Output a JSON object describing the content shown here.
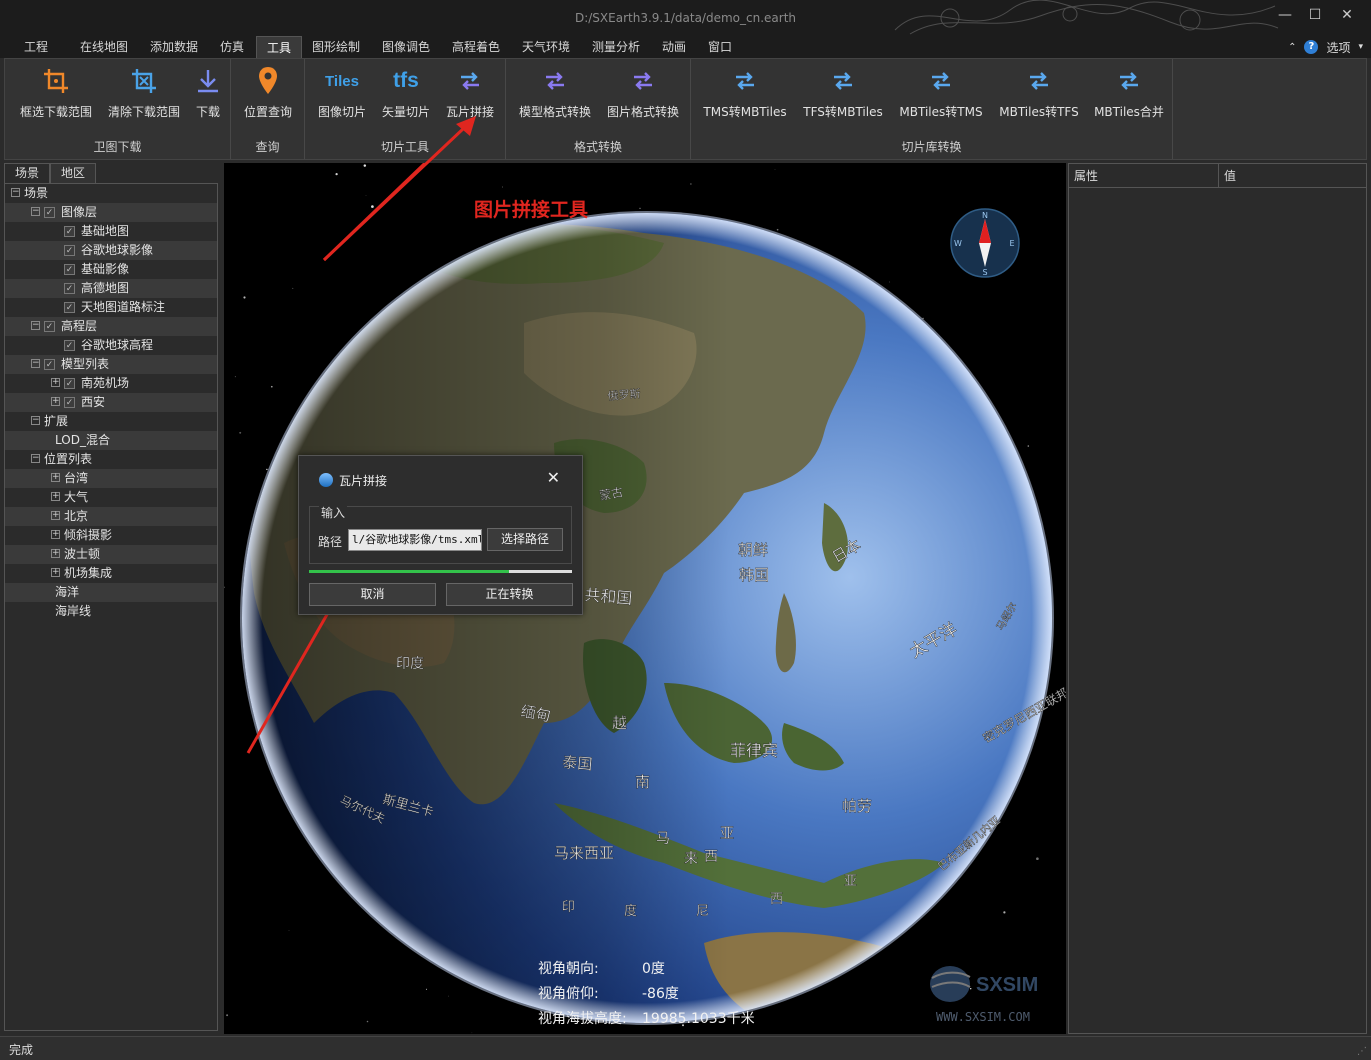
{
  "window": {
    "title": "D:/SXEarth3.9.1/data/demo_cn.earth"
  },
  "menu": {
    "items": [
      "工程",
      "在线地图",
      "添加数据",
      "仿真",
      "工具",
      "图形绘制",
      "图像调色",
      "高程着色",
      "天气环境",
      "测量分析",
      "动画",
      "窗口"
    ],
    "active": "工具",
    "options_label": "选项"
  },
  "ribbon": {
    "groups": [
      {
        "title": "卫图下载",
        "buttons": [
          {
            "label": "框选下载范围",
            "icon": "crop-select-icon"
          },
          {
            "label": "清除下载范围",
            "icon": "crop-clear-icon"
          },
          {
            "label": "下载",
            "icon": "download-icon"
          }
        ]
      },
      {
        "title": "查询",
        "buttons": [
          {
            "label": "位置查询",
            "icon": "location-pin-icon"
          }
        ]
      },
      {
        "title": "切片工具",
        "buttons": [
          {
            "label": "图像切片",
            "icon_text": "Tiles"
          },
          {
            "label": "矢量切片",
            "icon_text": "tfs"
          },
          {
            "label": "瓦片拼接",
            "icon": "swap-arrows-icon"
          }
        ]
      },
      {
        "title": "格式转换",
        "buttons": [
          {
            "label": "模型格式转换",
            "icon": "swap-arrows-icon"
          },
          {
            "label": "图片格式转换",
            "icon": "swap-arrows-icon"
          }
        ]
      },
      {
        "title": "切片库转换",
        "buttons": [
          {
            "label": "TMS转MBTiles"
          },
          {
            "label": "TFS转MBTiles"
          },
          {
            "label": "MBTiles转TMS"
          },
          {
            "label": "MBTiles转TFS"
          },
          {
            "label": "MBTiles合并"
          }
        ]
      }
    ]
  },
  "left_panel": {
    "tabs": [
      "场景",
      "地区"
    ],
    "tree": [
      {
        "label": "场景",
        "level": 0,
        "expander": "−",
        "check": false
      },
      {
        "label": "图像层",
        "level": 1,
        "expander": "−",
        "check": true
      },
      {
        "label": "基础地图",
        "level": 2,
        "expander": "",
        "check": true
      },
      {
        "label": "谷歌地球影像",
        "level": 2,
        "expander": "",
        "check": true
      },
      {
        "label": "基础影像",
        "level": 2,
        "expander": "",
        "check": true
      },
      {
        "label": "高德地图",
        "level": 2,
        "expander": "",
        "check": true
      },
      {
        "label": "天地图道路标注",
        "level": 2,
        "expander": "",
        "check": true
      },
      {
        "label": "高程层",
        "level": 1,
        "expander": "−",
        "check": true
      },
      {
        "label": "谷歌地球高程",
        "level": 2,
        "expander": "",
        "check": true
      },
      {
        "label": "模型列表",
        "level": 1,
        "expander": "−",
        "check": true
      },
      {
        "label": "南苑机场",
        "level": 2,
        "expander": "+",
        "check": true
      },
      {
        "label": "西安",
        "level": 2,
        "expander": "+",
        "check": true
      },
      {
        "label": "扩展",
        "level": 1,
        "expander": "−",
        "check": false
      },
      {
        "label": "LOD_混合",
        "level": 2,
        "expander": "",
        "check": false
      },
      {
        "label": "位置列表",
        "level": 1,
        "expander": "−",
        "check": false
      },
      {
        "label": "台湾",
        "level": 2,
        "expander": "+",
        "check": false
      },
      {
        "label": "大气",
        "level": 2,
        "expander": "+",
        "check": false
      },
      {
        "label": "北京",
        "level": 2,
        "expander": "+",
        "check": false
      },
      {
        "label": "倾斜摄影",
        "level": 2,
        "expander": "+",
        "check": false
      },
      {
        "label": "波士顿",
        "level": 2,
        "expander": "+",
        "check": false
      },
      {
        "label": "机场集成",
        "level": 2,
        "expander": "+",
        "check": false
      },
      {
        "label": "海洋",
        "level": 2,
        "expander": "",
        "check": false
      },
      {
        "label": "海岸线",
        "level": 2,
        "expander": "",
        "check": false
      }
    ]
  },
  "viewport": {
    "caption": "图片拼接工具",
    "globe_labels": [
      "俄罗斯",
      "蒙古",
      "朝鲜",
      "韩国",
      "日本",
      "共和国",
      "印度",
      "缅甸",
      "越",
      "泰国",
      "南",
      "菲律宾",
      "帕劳",
      "马来西亚",
      "马",
      "来",
      "西",
      "亚",
      "斯里兰卡",
      "马尔代夫",
      "印",
      "度",
      "尼",
      "西",
      "亚",
      "太平洋",
      "密克罗尼西亚联邦",
      "巴布亚新几内亚",
      "马绍尔"
    ],
    "compass": {
      "north": "N",
      "south": "S",
      "east": "E",
      "west": "W"
    },
    "hud": {
      "heading_label": "视角朝向:",
      "heading_value": "0度",
      "pitch_label": "视角俯仰:",
      "pitch_value": "-86度",
      "altitude_label": "视角海拔高度:",
      "altitude_value": "19985.1033千米"
    },
    "watermark": {
      "brand": "SXSIM",
      "url": "WWW.SXSIM.COM"
    },
    "accent_color": "#e0261f"
  },
  "dialog": {
    "title": "瓦片拼接",
    "group_label": "输入",
    "path_label": "路径",
    "path_value": "l/谷歌地球影像/tms.xml",
    "browse_label": "选择路径",
    "progress": 0.76,
    "cancel_label": "取消",
    "run_label": "正在转换"
  },
  "right_panel": {
    "columns": [
      "属性",
      "值"
    ]
  },
  "status": {
    "text": "完成"
  }
}
